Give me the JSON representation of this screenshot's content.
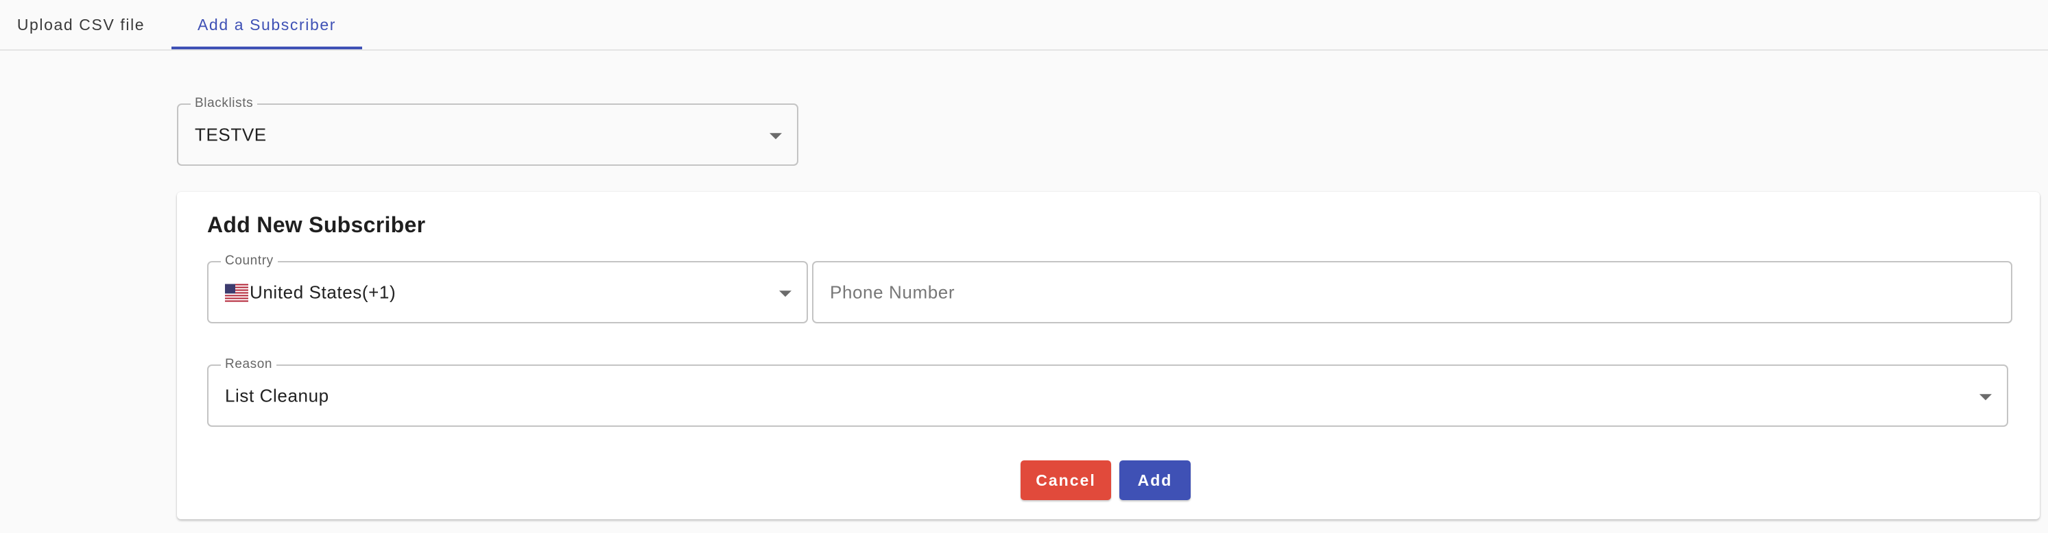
{
  "tabs": [
    {
      "label": "Upload CSV file",
      "active": false
    },
    {
      "label": "Add a Subscriber",
      "active": true
    }
  ],
  "blacklists": {
    "label": "Blacklists",
    "value": "TESTVE"
  },
  "card": {
    "title": "Add New Subscriber",
    "country": {
      "label": "Country",
      "value": "United States(+1)",
      "flag_icon": "us-flag-icon"
    },
    "phone": {
      "placeholder": "Phone Number",
      "value": ""
    },
    "reason": {
      "label": "Reason",
      "value": "List Cleanup"
    },
    "buttons": {
      "cancel": "Cancel",
      "add": "Add"
    }
  },
  "colors": {
    "accent": "#3f51b5",
    "cancel": "#e14a3b",
    "background": "#fafafa"
  }
}
